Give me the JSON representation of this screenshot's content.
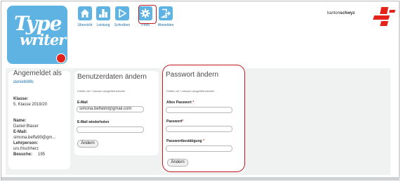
{
  "logo": {
    "line1": "Type",
    "line2": "writer"
  },
  "nav": {
    "items": [
      {
        "label": "Übersicht",
        "icon": "home-icon"
      },
      {
        "label": "Leistung",
        "icon": "chart-icon"
      },
      {
        "label": "Schreiben",
        "icon": "play-icon"
      },
      {
        "label": "Profil",
        "icon": "gear-icon"
      },
      {
        "label": "Abmelden",
        "icon": "logout-icon"
      }
    ]
  },
  "brand": {
    "prefix": "kanton",
    "name": "schwyz"
  },
  "user": {
    "heading": "Angemeldet als",
    "username": "danielb88s",
    "klasse_label": "Klasse:",
    "klasse": "5. Klasse 2019/20",
    "name_label": "Name:",
    "name": "Daniel Blaser",
    "email_label": "E-Mail:",
    "email": "simona.beffa90@gm...",
    "lehrperson_label": "Lehrperson:",
    "lehrperson": "urs.frischherz",
    "besuche_label": "Besuche:",
    "besuche": "195"
  },
  "userdata": {
    "heading": "Benutzerdaten ändern",
    "note": "Felder mit * müssen ausgefüllt werden",
    "email_label": "E-Mail",
    "email_value": "simona.beffa90@gmail.com",
    "email_repeat_label": "E-Mail wiederholen",
    "email_repeat_value": "",
    "submit": "Ändern"
  },
  "password": {
    "heading": "Passwort ändern",
    "note": "Felder mit * müssen ausgefüllt werden",
    "old_label": "Altes Passwort",
    "new_label": "Passwort",
    "confirm_label": "Passwortbestätigung",
    "required_mark": "*",
    "submit": "Ändern"
  },
  "colors": {
    "accent": "#5fb3e2",
    "highlight": "#c21a22",
    "brand_red": "#e32219"
  }
}
